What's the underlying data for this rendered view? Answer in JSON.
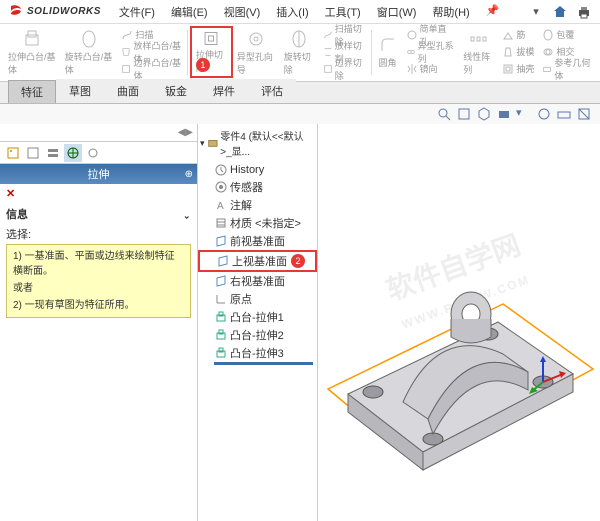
{
  "app": {
    "name": "SOLIDWORKS"
  },
  "menu": [
    "文件(F)",
    "编辑(E)",
    "视图(V)",
    "插入(I)",
    "工具(T)",
    "窗口(W)",
    "帮助(H)"
  ],
  "ribbon": {
    "extrude": "拉伸凸台/基体",
    "revolve": "旋转凸台/基体",
    "sweep": "扫描",
    "loft": "放样凸台/基体",
    "boundary": "边界凸台/基体",
    "extrude_cut": "拉伸切除",
    "hole": "异型孔向导",
    "rev_cut": "旋转切除",
    "sweep_cut": "扫描切除",
    "loft_cut": "放样切割",
    "bound_cut": "边界切除",
    "fillet": "圆角",
    "simple_hole": "简单直孔",
    "hole_series": "异型孔系列",
    "mirror": "镜向",
    "lpattern": "线性阵列",
    "rib": "筋",
    "draft": "拔模",
    "shell": "抽壳",
    "wrap": "包覆",
    "intersect": "相交",
    "refgeo": "参考几何体"
  },
  "tabs": [
    "特征",
    "草图",
    "曲面",
    "钣金",
    "焊件",
    "评估"
  ],
  "panel": {
    "title": "拉伸",
    "info_hdr": "信息",
    "select_hdr": "选择:",
    "msg1": "1) 一基准面、平面或边线来绘制特征横断面。",
    "or": "或者",
    "msg2": "2) 一现有草图为特征所用。"
  },
  "tree": {
    "root": "零件4 (默认<<默认>_显...",
    "history": "History",
    "sensors": "传感器",
    "annot": "注解",
    "material": "材质 <未指定>",
    "front": "前视基准面",
    "top": "上视基准面",
    "right": "右视基准面",
    "origin": "原点",
    "ext1": "凸台-拉伸1",
    "ext2": "凸台-拉伸2",
    "ext3": "凸台-拉伸3"
  },
  "watermark": {
    "big1": "软件",
    "big2": "自学网",
    "url": "WWW.RJZXW.COM"
  }
}
